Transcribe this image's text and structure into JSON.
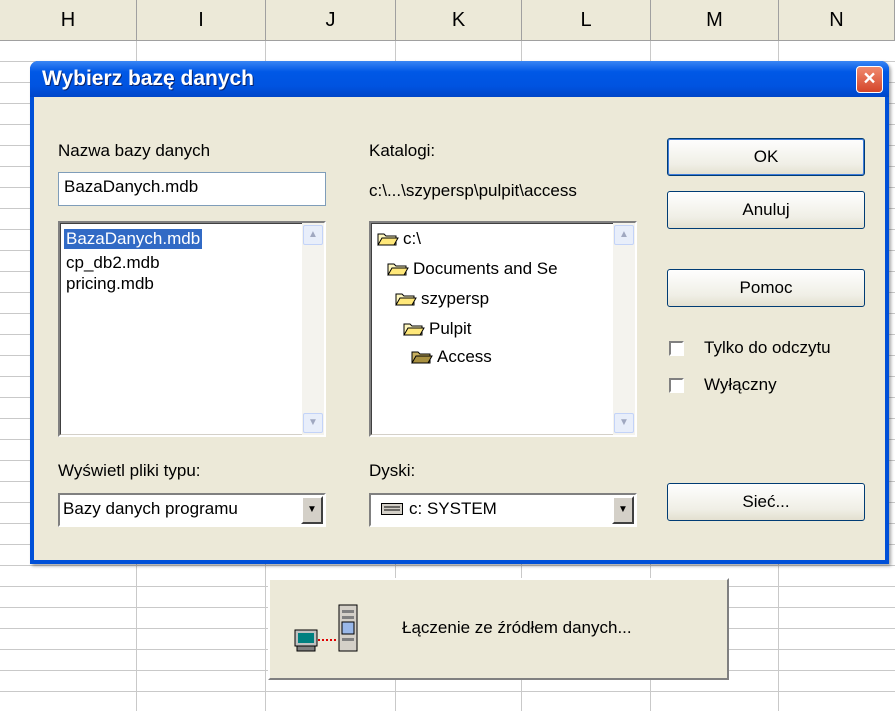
{
  "sheet": {
    "columns": [
      "H",
      "I",
      "J",
      "K",
      "L",
      "M",
      "N"
    ]
  },
  "dialog": {
    "title": "Wybierz bazę danych",
    "close_label": "×",
    "db_name_label": "Nazwa bazy danych",
    "db_name_value": "BazaDanych.mdb",
    "files": [
      "BazaDanych.mdb",
      "cp_db2.mdb",
      "pricing.mdb"
    ],
    "selected_file": "BazaDanych.mdb",
    "catalogs_label": "Katalogi:",
    "current_path": "c:\\...\\szypersp\\pulpit\\access",
    "folders": [
      "c:\\",
      "Documents and Se",
      "szypersp",
      "Pulpit",
      "Access"
    ],
    "file_type_label": "Wyświetl pliki typu:",
    "file_type_value": "Bazy danych programu",
    "drives_label": "Dyski:",
    "drive_value": "c: SYSTEM",
    "buttons": {
      "ok": "OK",
      "cancel": "Anuluj",
      "help": "Pomoc",
      "network": "Sieć..."
    },
    "readonly_label": "Tylko do odczytu",
    "exclusive_label": "Wyłączny"
  },
  "connection_bar": {
    "label": "Łączenie ze źródłem danych..."
  },
  "colors": {
    "title_bar": "#0054e3",
    "dialog_bg": "#ece9d8",
    "selection": "#316ac5"
  }
}
